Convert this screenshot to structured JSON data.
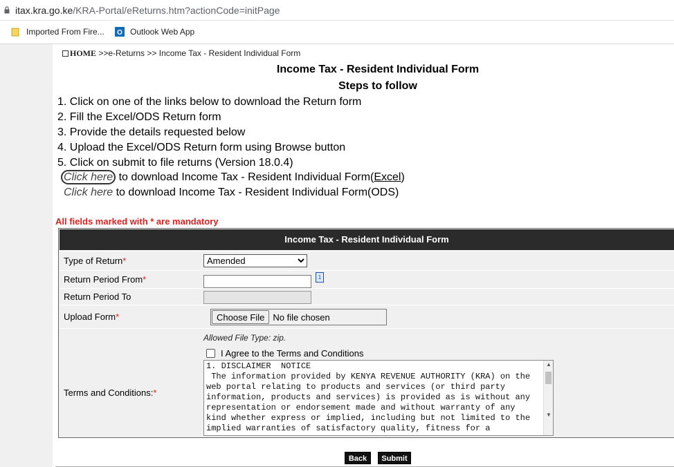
{
  "browser": {
    "url_host": "itax.kra.go.ke",
    "url_path": "/KRA-Portal/eReturns.htm?actionCode=initPage",
    "bookmarks": [
      {
        "label": "Imported From Fire..."
      },
      {
        "label": "Outlook Web App"
      }
    ]
  },
  "breadcrumb": {
    "home": "HOME",
    "trail": ">>e-Returns >> Income Tax - Resident Individual Form"
  },
  "page": {
    "title": "Income Tax - Resident Individual Form",
    "subtitle": "Steps to follow",
    "steps": [
      "1. Click on one of the links below to download the Return form",
      "2. Fill the Excel/ODS Return form",
      "3. Provide the details requested below",
      "4. Upload the Excel/ODS Return form using Browse button",
      "5. Click on submit to file returns (Version 18.0.4)"
    ],
    "download_excel": {
      "link": "Click here",
      "text": " to download Income Tax - Resident Individual Form(",
      "fmt": "Excel",
      "close": ")"
    },
    "download_ods": {
      "link": "Click here",
      "text": " to download Income Tax - Resident Individual Form(ODS)"
    },
    "mandatory_note": "All fields marked with * are mandatory"
  },
  "form": {
    "header": "Income Tax - Resident Individual Form",
    "type_of_return_label": "Type of Return",
    "type_of_return_value": "Amended",
    "period_from_label": "Return Period From",
    "period_to_label": "Return Period To",
    "upload_label": "Upload Form",
    "choose_file": "Choose File",
    "no_file": "No file chosen",
    "allowed_type": "Allowed File Type: zip.",
    "agree_label": "I Agree to the Terms and Conditions",
    "terms_label": "Terms and Conditions:",
    "required_mark": "*",
    "terms_text": "1. DISCLAIMER  NOTICE\n The information provided by KENYA REVENUE AUTHORITY (KRA) on the\nweb portal relating to products and services (or third party\ninformation, products and services) is provided as is without any\nrepresentation or endorsement made and without warranty of any\nkind whether express or implied, including but not limited to the\nimplied warranties of satisfactory quality, fitness for a"
  },
  "buttons": {
    "back": "Back",
    "submit": "Submit"
  }
}
